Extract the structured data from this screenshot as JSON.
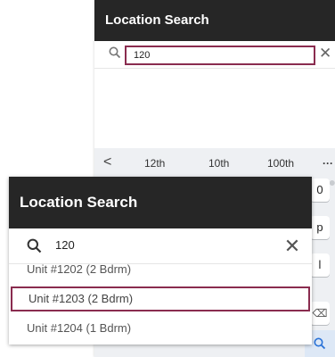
{
  "back_screen": {
    "title": "Location Search",
    "search": {
      "value": "120",
      "clear_icon": "close-icon",
      "search_icon": "search-icon"
    },
    "keyboard": {
      "suggestions": [
        "12th",
        "10th",
        "100th"
      ],
      "more": "···",
      "back_chevron": "<",
      "keys": {
        "zero": "0",
        "p": "p",
        "l": "l",
        "backspace": "⌫",
        "enter": "Q"
      }
    }
  },
  "front_screen": {
    "title": "Location Search",
    "search": {
      "value": "120",
      "clear_label": "✕"
    },
    "results": [
      {
        "label": "Unit #1202 (2 Bdrm)"
      },
      {
        "label": "Unit #1203 (2 Bdrm)",
        "highlighted": true
      },
      {
        "label": "Unit #1204 (1 Bdrm)"
      }
    ]
  },
  "colors": {
    "header_bg": "#262626",
    "highlight_border": "#8a2c4f",
    "keyboard_bg": "#eef0f3",
    "enter_key": "#2a73d8"
  }
}
